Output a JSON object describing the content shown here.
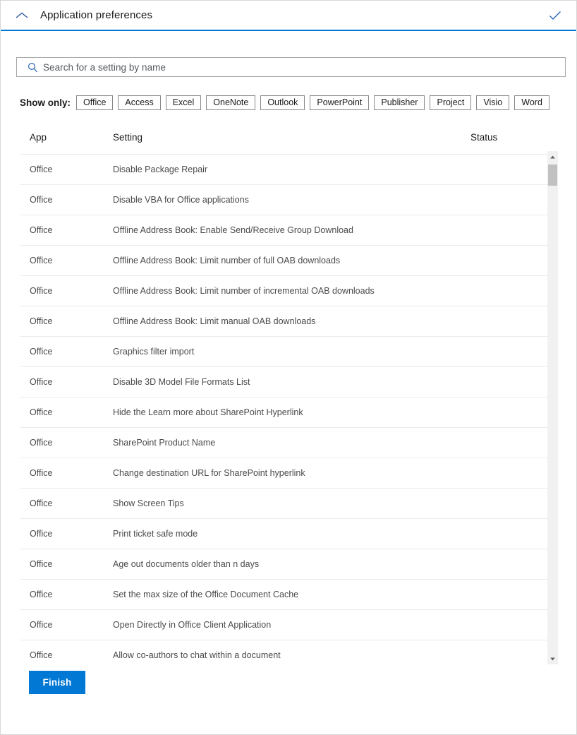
{
  "header": {
    "title": "Application preferences",
    "collapse_icon": "chevron-up-icon",
    "confirm_icon": "checkmark-icon",
    "accent_color": "#0078d4"
  },
  "search": {
    "placeholder": "Search for a setting by name",
    "value": "",
    "icon": "search-icon"
  },
  "filters": {
    "label": "Show only:",
    "buttons": [
      "Office",
      "Access",
      "Excel",
      "OneNote",
      "Outlook",
      "PowerPoint",
      "Publisher",
      "Project",
      "Visio",
      "Word"
    ]
  },
  "table": {
    "columns": [
      "App",
      "Setting",
      "Status"
    ],
    "rows": [
      {
        "app": "Office",
        "setting": "Disable Package Repair",
        "status": ""
      },
      {
        "app": "Office",
        "setting": "Disable VBA for Office applications",
        "status": ""
      },
      {
        "app": "Office",
        "setting": "Offline Address Book: Enable Send/Receive Group Download",
        "status": ""
      },
      {
        "app": "Office",
        "setting": "Offline Address Book: Limit number of full OAB downloads",
        "status": ""
      },
      {
        "app": "Office",
        "setting": "Offline Address Book: Limit number of incremental OAB downloads",
        "status": ""
      },
      {
        "app": "Office",
        "setting": "Offline Address Book: Limit manual OAB downloads",
        "status": ""
      },
      {
        "app": "Office",
        "setting": "Graphics filter import",
        "status": ""
      },
      {
        "app": "Office",
        "setting": "Disable 3D Model File Formats List",
        "status": ""
      },
      {
        "app": "Office",
        "setting": "Hide the Learn more about SharePoint Hyperlink",
        "status": ""
      },
      {
        "app": "Office",
        "setting": "SharePoint Product Name",
        "status": ""
      },
      {
        "app": "Office",
        "setting": "Change destination URL for SharePoint hyperlink",
        "status": ""
      },
      {
        "app": "Office",
        "setting": "Show Screen Tips",
        "status": ""
      },
      {
        "app": "Office",
        "setting": "Print ticket safe mode",
        "status": ""
      },
      {
        "app": "Office",
        "setting": "Age out documents older than n days",
        "status": ""
      },
      {
        "app": "Office",
        "setting": "Set the max size of the Office Document Cache",
        "status": ""
      },
      {
        "app": "Office",
        "setting": "Open Directly in Office Client Application",
        "status": ""
      },
      {
        "app": "Office",
        "setting": "Allow co-authors to chat within a document",
        "status": ""
      }
    ]
  },
  "scrollbar": {
    "up_icon": "scroll-up-arrow-icon",
    "down_icon": "scroll-down-arrow-icon"
  },
  "footer": {
    "finish_label": "Finish",
    "finish_color": "#0078d4"
  }
}
